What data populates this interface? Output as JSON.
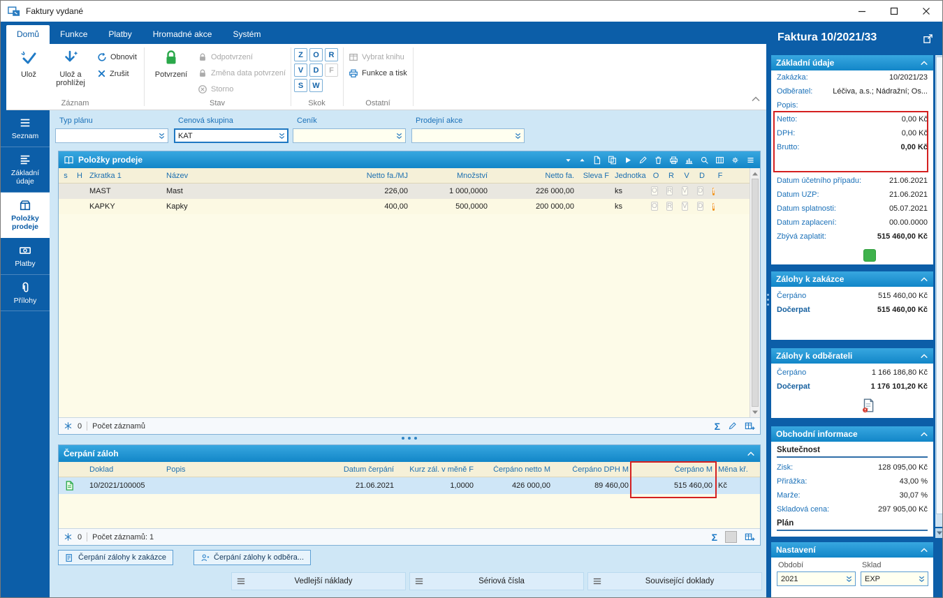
{
  "window": {
    "title": "Faktury vydané"
  },
  "icons": {
    "sum": "Σ"
  },
  "tabs": [
    {
      "label": "Domů"
    },
    {
      "label": "Funkce"
    },
    {
      "label": "Platby"
    },
    {
      "label": "Hromadné akce"
    },
    {
      "label": "Systém"
    }
  ],
  "ribbon": {
    "save": "Ulož",
    "save_and_view": "Ulož a prohlížej",
    "refresh": "Obnovit",
    "cancel": "Zrušit",
    "group_record": "Záznam",
    "confirm": "Potvrzení",
    "unconfirm": "Odpotvrzení",
    "change_date": "Změna data potvrzení",
    "storno": "Storno",
    "group_state": "Stav",
    "jump": [
      "Z",
      "O",
      "R",
      "V",
      "D",
      "F",
      "S",
      "W"
    ],
    "group_jump": "Skok",
    "select_book": "Vybrat knihu",
    "functions_print": "Funkce a tisk",
    "group_other": "Ostatní"
  },
  "sidebar": [
    {
      "label": "Seznam"
    },
    {
      "label": "Základní údaje"
    },
    {
      "label": "Položky prodeje"
    },
    {
      "label": "Platby"
    },
    {
      "label": "Přílohy"
    }
  ],
  "filters": [
    {
      "label": "Typ plánu",
      "value": ""
    },
    {
      "label": "Cenová skupina",
      "value": "KAT"
    },
    {
      "label": "Ceník",
      "value": ""
    },
    {
      "label": "Prodejní akce",
      "value": ""
    }
  ],
  "items": {
    "title": "Položky prodeje",
    "columns": [
      "s",
      "H",
      "Zkratka 1",
      "Název",
      "Netto fa./MJ",
      "Množství",
      "Netto fa.",
      "Sleva F",
      "Jednotka",
      "O",
      "R",
      "V",
      "D",
      "F"
    ],
    "rows": [
      {
        "zkratka": "MAST",
        "nazev": "Mast",
        "netto_mj": "226,00",
        "mnozstvi": "1 000,0000",
        "netto": "226 000,00",
        "sleva": "",
        "jednotka": "ks",
        "o": "O",
        "r": "R",
        "v": "V",
        "d": "D",
        "f": "f"
      },
      {
        "zkratka": "KAPKY",
        "nazev": "Kapky",
        "netto_mj": "400,00",
        "mnozstvi": "500,0000",
        "netto": "200 000,00",
        "sleva": "",
        "jednotka": "ks",
        "o": "O",
        "r": "R",
        "v": "V",
        "d": "D",
        "f": "f"
      }
    ],
    "count": "0",
    "count_label": "Počet záznamů"
  },
  "advances": {
    "title": "Čerpání záloh",
    "columns": [
      "Doklad",
      "Popis",
      "Datum čerpání",
      "Kurz zál. v měně F",
      "Čerpáno netto M",
      "Čerpáno DPH M",
      "Čerpáno M",
      "Měna kř."
    ],
    "row": {
      "doklad": "10/2021/100005",
      "popis": "",
      "datum": "21.06.2021",
      "kurz": "1,0000",
      "netto": "426 000,00",
      "dph": "89 460,00",
      "celkem": "515 460,00",
      "mena": "Kč"
    },
    "count": "0",
    "count_label": "Počet záznamů: 1",
    "btn_order": "Čerpání zálohy k zakázce",
    "btn_customer": "Čerpání zálohy k odběra..."
  },
  "bottom": [
    {
      "label": "Vedlejší náklady"
    },
    {
      "label": "Sériová čísla"
    },
    {
      "label": "Související doklady"
    }
  ],
  "detail": {
    "title": "Faktura 10/2021/33",
    "basic": {
      "header": "Základní údaje",
      "rows": [
        {
          "label": "Zakázka:",
          "value": "10/2021/23"
        },
        {
          "label": "Odběratel:",
          "value": "Léčiva, a.s.; Nádražní; Os..."
        },
        {
          "label": "Popis:",
          "value": ""
        }
      ],
      "amounts": [
        {
          "label": "Netto:",
          "value": "0,00 Kč"
        },
        {
          "label": "DPH:",
          "value": "0,00 Kč"
        },
        {
          "label": "Brutto:",
          "value": "0,00 Kč"
        }
      ],
      "dates": [
        {
          "label": "Datum účetního případu:",
          "value": "21.06.2021"
        },
        {
          "label": "Datum UZP:",
          "value": "21.06.2021"
        },
        {
          "label": "Datum splatnosti:",
          "value": "05.07.2021"
        },
        {
          "label": "Datum zaplacení:",
          "value": "00.00.0000"
        },
        {
          "label": "Zbývá zaplatit:",
          "value": "515 460,00 Kč"
        }
      ]
    },
    "adv_order": {
      "header": "Zálohy k zakázce",
      "rows": [
        {
          "label": "Čerpáno",
          "value": "515 460,00 Kč"
        },
        {
          "label": "Dočerpat",
          "value": "515 460,00 Kč"
        }
      ]
    },
    "adv_customer": {
      "header": "Zálohy k odběrateli",
      "rows": [
        {
          "label": "Čerpáno",
          "value": "1 166 186,80 Kč"
        },
        {
          "label": "Dočerpat",
          "value": "1 176 101,20 Kč"
        }
      ]
    },
    "business": {
      "header": "Obchodní informace",
      "actual": "Skutečnost",
      "rows": [
        {
          "label": "Zisk:",
          "value": "128 095,00 Kč"
        },
        {
          "label": "Přirážka:",
          "value": "43,00 %"
        },
        {
          "label": "Marže:",
          "value": "30,07 %"
        },
        {
          "label": "Skladová cena:",
          "value": "297 905,00 Kč"
        }
      ],
      "plan": "Plán"
    },
    "settings": {
      "header": "Nastavení",
      "period_label": "Období",
      "period": "2021",
      "warehouse_label": "Sklad",
      "warehouse": "EXP"
    }
  },
  "colors": {
    "app_blue": "#0c5ea8",
    "section_header_blue": "#1e96d6",
    "highlight_red": "#d42020",
    "flag_orange": "#f0951e",
    "status_green": "#3fb24c"
  }
}
